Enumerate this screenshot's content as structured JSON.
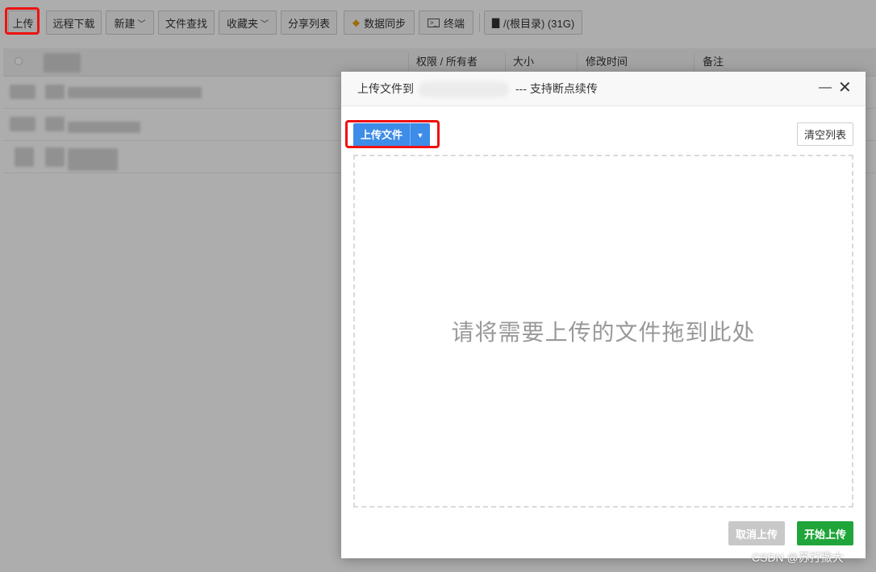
{
  "toolbar": {
    "upload": "上传",
    "remote_download": "远程下载",
    "new": "新建",
    "file_search": "文件查找",
    "favorites": "收藏夹",
    "share_list": "分享列表",
    "data_sync": "数据同步",
    "terminal": "终端",
    "root_dir": "/(根目录) (31G)"
  },
  "file_list": {
    "columns": [
      "权限 / 所有者",
      "大小",
      "修改时间",
      "备注"
    ]
  },
  "dialog": {
    "title_prefix": "上传文件到",
    "title_suffix": "--- 支持断点续传",
    "upload_files": "上传文件",
    "clear_list": "清空列表",
    "drop_hint": "请将需要上传的文件拖到此处",
    "cancel_upload": "取消上传",
    "start_upload": "开始上传"
  },
  "watermark": "CSDN @苏打撒大",
  "colors": {
    "accent_blue": "#3d8ce8",
    "success_green": "#20a53a",
    "highlight_red": "#ee1111",
    "disabled_gray": "#c8c8c8"
  }
}
